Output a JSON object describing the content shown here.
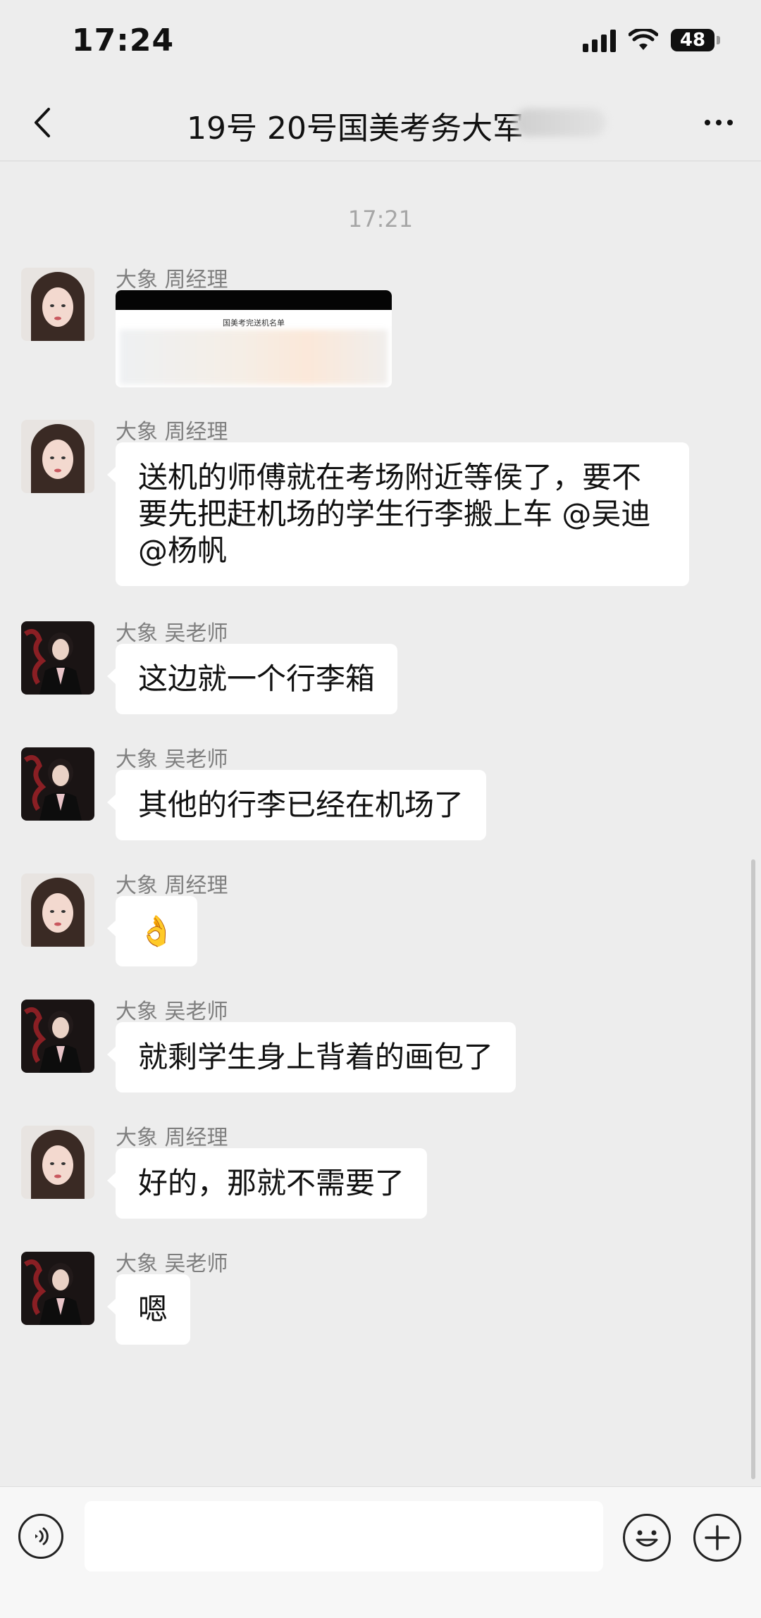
{
  "status_bar": {
    "time": "17:24",
    "battery": "48"
  },
  "nav": {
    "title": "19号 20号国美考务大军"
  },
  "timestamp": "17:21",
  "image_preview": {
    "title": "国美考完送机名单"
  },
  "senders": {
    "zhou": "大象 周经理",
    "wu": "大象 吴老师"
  },
  "messages": [
    {
      "sender": "大象 周经理",
      "type": "image"
    },
    {
      "sender": "大象 周经理",
      "text": "送机的师傅就在考场附近等侯了，要不要先把赶机场的学生行李搬上车 @吴迪 @杨帆"
    },
    {
      "sender": "大象 吴老师",
      "text": "这边就一个行李箱"
    },
    {
      "sender": "大象 吴老师",
      "text": "其他的行李已经在机场了"
    },
    {
      "sender": "大象 周经理",
      "text": "👌"
    },
    {
      "sender": "大象 吴老师",
      "text": "就剩学生身上背着的画包了"
    },
    {
      "sender": "大象 周经理",
      "text": "好的，那就不需要了"
    },
    {
      "sender": "大象 吴老师",
      "text": "嗯"
    }
  ],
  "input": {
    "placeholder": ""
  },
  "icons": {
    "back": "chevron-left-icon",
    "more": "more-dots-icon",
    "voice": "voice-icon",
    "emoji": "emoji-icon",
    "plus": "plus-icon"
  }
}
